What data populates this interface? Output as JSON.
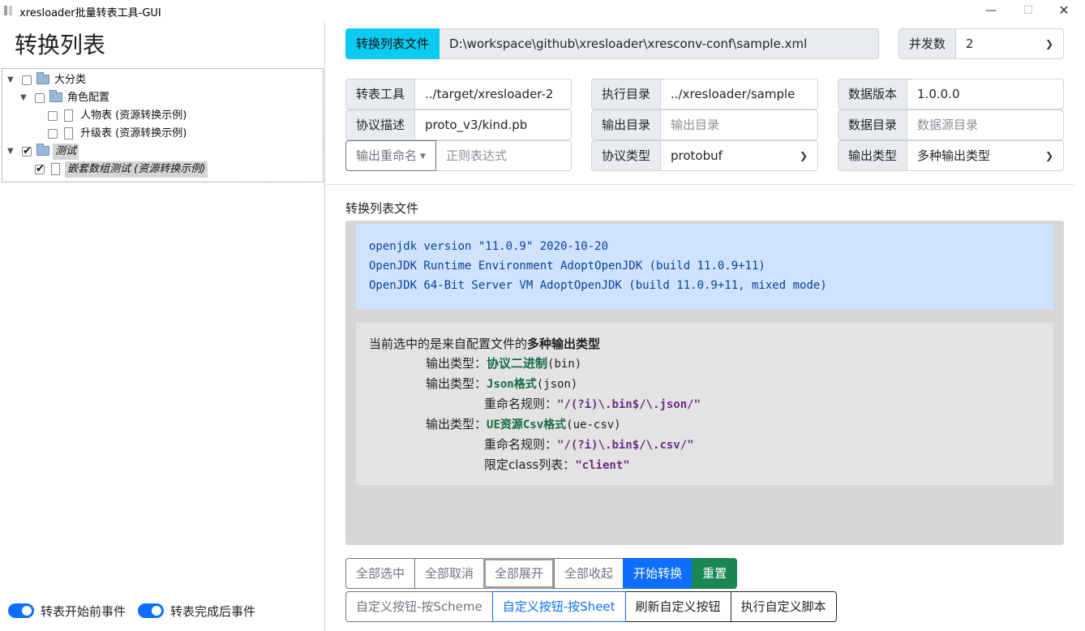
{
  "window": {
    "title": "xresloader批量转表工具-GUI",
    "minimize": "—",
    "maximize": "☐",
    "close": "✕"
  },
  "left": {
    "title": "转换列表",
    "tree": [
      {
        "label": "大分类",
        "type": "folder",
        "checked": false
      },
      {
        "label": "角色配置",
        "type": "folder",
        "checked": false
      },
      {
        "label": "人物表 (资源转换示例)",
        "type": "file",
        "checked": false
      },
      {
        "label": "升级表 (资源转换示例)",
        "type": "file",
        "checked": false
      },
      {
        "label": "测试",
        "type": "folder",
        "checked": true
      },
      {
        "label": "嵌套数组测试 (资源转换示例)",
        "type": "file",
        "checked": true
      }
    ],
    "switches": {
      "before": "转表开始前事件",
      "after": "转表完成后事件"
    }
  },
  "config": {
    "list_file_label": "转换列表文件",
    "list_file_value": "D:\\workspace\\github\\xresloader\\xresconv-conf\\sample.xml",
    "concurrency_label": "并发数",
    "concurrency_value": "2",
    "tool_label": "转表工具",
    "tool_value": "../target/xresloader-2",
    "exec_dir_label": "执行目录",
    "exec_dir_value": "../xresloader/sample",
    "data_version_label": "数据版本",
    "data_version_value": "1.0.0.0",
    "proto_desc_label": "协议描述",
    "proto_desc_value": "proto_v3/kind.pb",
    "output_dir_label": "输出目录",
    "output_dir_placeholder": "输出目录",
    "data_dir_label": "数据目录",
    "data_dir_placeholder": "数据源目录",
    "rename_label": "输出重命名",
    "rename_placeholder": "正则表达式",
    "proto_type_label": "协议类型",
    "proto_type_value": "protobuf",
    "output_type_label": "输出类型",
    "output_type_value": "多种输出类型"
  },
  "log": {
    "section_label": "转换列表文件",
    "java_lines": [
      "openjdk version \"11.0.9\" 2020-10-20",
      "OpenJDK Runtime Environment AdoptOpenJDK (build 11.0.9+11)",
      "OpenJDK 64-Bit Server VM AdoptOpenJDK (build 11.0.9+11, mixed mode)"
    ],
    "info": {
      "intro_prefix": "当前选中的是来自配置文件的",
      "intro_bold": "多种输出类型",
      "type_label": "输出类型：",
      "rename_label": "重命名规则：",
      "class_label": "限定class列表：",
      "t1_name": "协议二进制",
      "t1_code": "(bin)",
      "t2_name": "Json格式",
      "t2_code": "(json)",
      "t2_rule": "\"/(?i)\\.bin$/\\.json/\"",
      "t3_name": "UE资源Csv格式",
      "t3_code": "(ue-csv)",
      "t3_rule": "\"/(?i)\\.bin$/\\.csv/\"",
      "t3_class": "\"client\""
    }
  },
  "actions": {
    "select_all": "全部选中",
    "deselect_all": "全部取消",
    "expand_all": "全部展开",
    "collapse_all": "全部收起",
    "start": "开始转换",
    "reset": "重置",
    "custom_scheme": "自定义按钮-按Scheme",
    "custom_sheet": "自定义按钮-按Sheet",
    "refresh_custom": "刷新自定义按钮",
    "run_script": "执行自定义脚本"
  },
  "colors": {
    "primary": "#0d6efd",
    "info": "#0dcaf0",
    "success": "#198754",
    "log_blue_bg": "#cfe2ff"
  }
}
